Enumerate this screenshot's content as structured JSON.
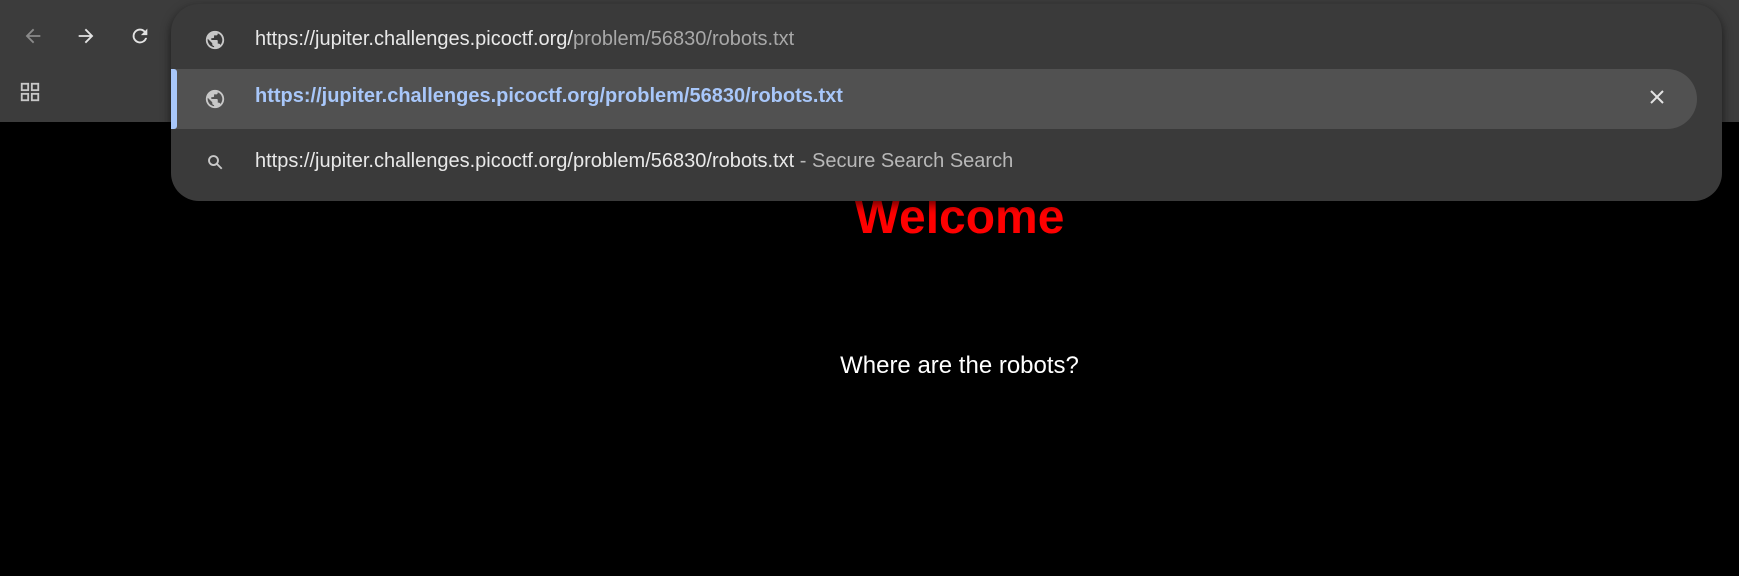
{
  "browser": {
    "icons": {
      "back": "arrow-left-icon",
      "forward": "arrow-right-icon",
      "reload": "reload-icon",
      "apps": "apps-grid-icon"
    },
    "colors": {
      "toolbar_bg": "#3c3c3c",
      "omnibox_bg": "#3a3a3a",
      "selected_bg": "#515151",
      "accent_blue": "#a8c7fa"
    }
  },
  "omnibox": {
    "input": {
      "url_host": "https://jupiter.challenges.picoctf.org/",
      "url_path": "problem/56830/robots.txt",
      "icon": "globe-icon"
    },
    "suggestions": [
      {
        "text": "https://jupiter.challenges.picoctf.org/problem/56830/robots.txt",
        "icon": "globe-icon",
        "remove_icon": "close-icon"
      },
      {
        "text": "https://jupiter.challenges.picoctf.org/problem/56830/robots.txt",
        "separator": " - ",
        "engine": "Secure Search Search",
        "icon": "search-icon"
      }
    ]
  },
  "page": {
    "heading": "Welcome",
    "body_text": "Where are the robots?",
    "heading_color": "#ff0000"
  }
}
